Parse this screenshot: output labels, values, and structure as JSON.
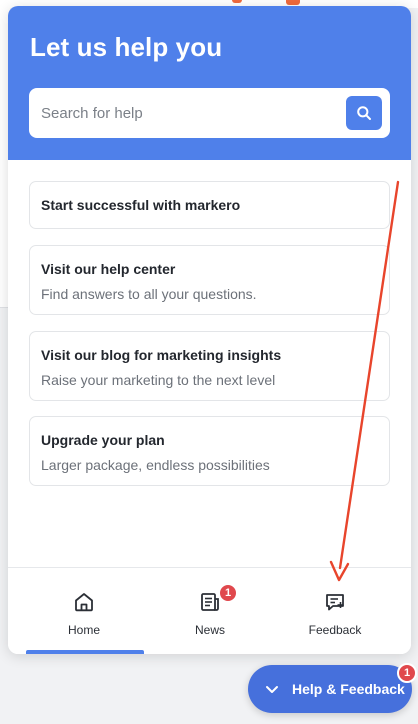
{
  "widget": {
    "title": "Let us help you",
    "search": {
      "placeholder": "Search for help",
      "value": ""
    }
  },
  "cards": [
    {
      "title": "Start successful with markero",
      "subtitle": ""
    },
    {
      "title": "Visit our help center",
      "subtitle": "Find answers to all your questions."
    },
    {
      "title": "Visit our blog for marketing insights",
      "subtitle": "Raise your marketing to the next level"
    },
    {
      "title": "Upgrade your plan",
      "subtitle": "Larger package, endless possibilities"
    }
  ],
  "nav": {
    "items": [
      {
        "label": "Home",
        "icon": "home-icon"
      },
      {
        "label": "News",
        "icon": "news-icon",
        "badge": "1"
      },
      {
        "label": "Feedback",
        "icon": "feedback-icon"
      }
    ],
    "active": "Home"
  },
  "launcher": {
    "label": "Help & Feedback",
    "badge": "1",
    "icon": "chevron-down-icon"
  },
  "colors": {
    "primary": "#4f80ea",
    "launcher": "#4670dc",
    "badge": "#e0484d",
    "annotation": "#e8452c"
  }
}
